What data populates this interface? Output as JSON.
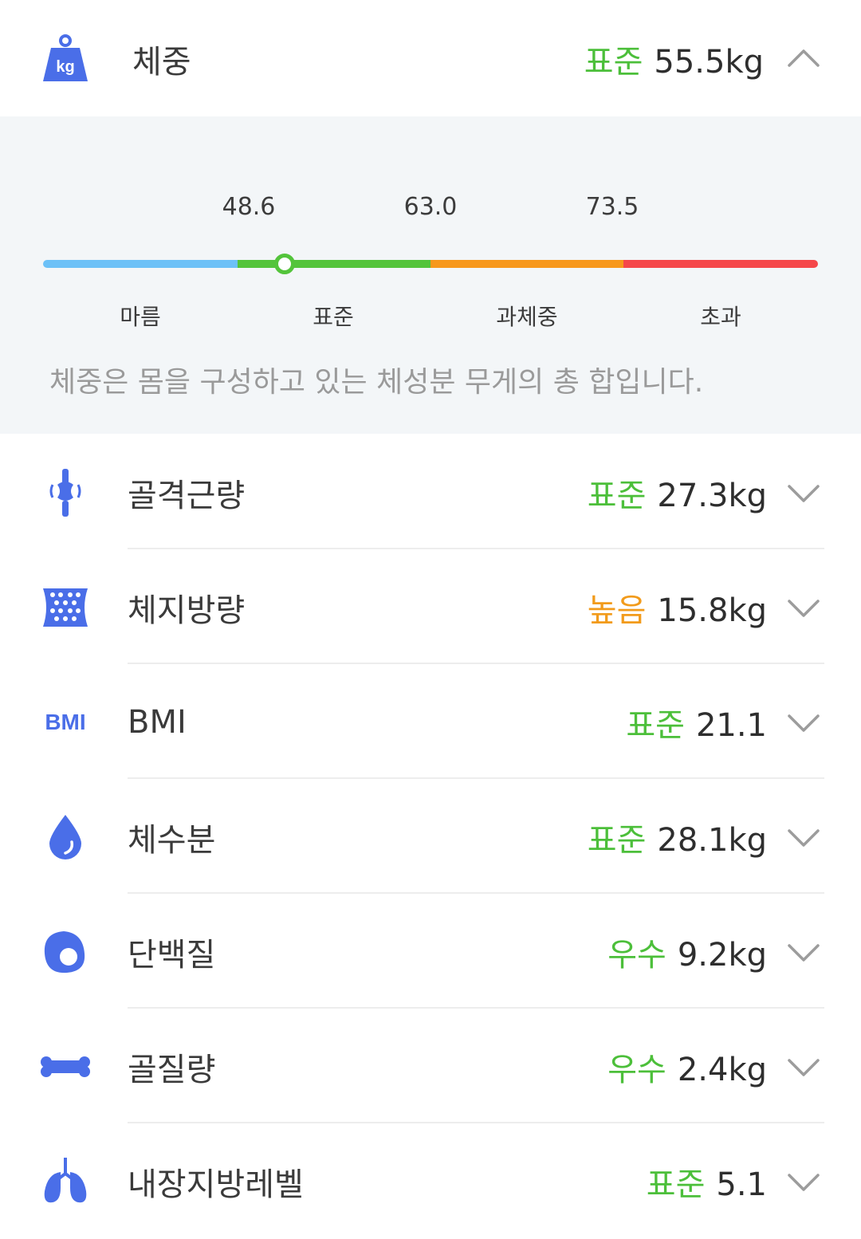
{
  "colors": {
    "icon_blue": "#4a6ee8",
    "standard_green": "#4cbf3a",
    "high_orange": "#f29b1b",
    "chevron_gray": "#9c9c9c"
  },
  "weight": {
    "label": "체중",
    "status": "표준",
    "status_color": "#4cbf3a",
    "value": "55.5kg",
    "icon": "kg-weight-icon",
    "icon_text": "kg",
    "expanded": true,
    "scale": {
      "thresholds": [
        "48.6",
        "63.0",
        "73.5"
      ],
      "segments": [
        "마름",
        "표준",
        "과체중",
        "초과"
      ],
      "segment_colors": [
        "#6cc1f7",
        "#53c43b",
        "#f7981c",
        "#f5474a"
      ]
    },
    "description": "체중은 몸을 구성하고 있는 체성분 무게의 총 합입니다."
  },
  "metrics": [
    {
      "label": "골격근량",
      "status": "표준",
      "status_color": "#4cbf3a",
      "value": "27.3kg",
      "icon": "joint-icon"
    },
    {
      "label": "체지방량",
      "status": "높음",
      "status_color": "#f29b1b",
      "value": "15.8kg",
      "icon": "fat-mesh-icon"
    },
    {
      "label": "BMI",
      "status": "표준",
      "status_color": "#4cbf3a",
      "value": "21.1",
      "icon": "bmi-icon",
      "icon_text": "BMI"
    },
    {
      "label": "체수분",
      "status": "표준",
      "status_color": "#4cbf3a",
      "value": "28.1kg",
      "icon": "water-drop-icon"
    },
    {
      "label": "단백질",
      "status": "우수",
      "status_color": "#4cbf3a",
      "value": "9.2kg",
      "icon": "protein-egg-icon"
    },
    {
      "label": "골질량",
      "status": "우수",
      "status_color": "#4cbf3a",
      "value": "2.4kg",
      "icon": "bone-icon"
    },
    {
      "label": "내장지방레벨",
      "status": "표준",
      "status_color": "#4cbf3a",
      "value": "5.1",
      "icon": "lungs-icon"
    }
  ]
}
